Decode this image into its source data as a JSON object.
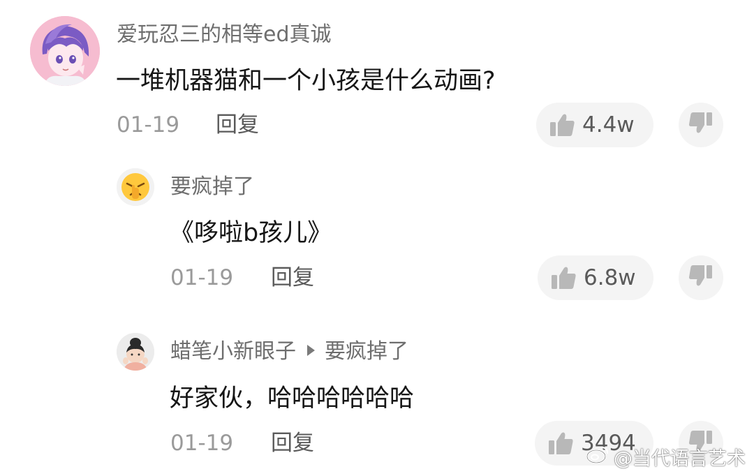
{
  "comments": [
    {
      "username": "爱玩忍三的相等ed真诚",
      "text": "一堆机器猫和一个小孩是什么动画?",
      "date": "01-19",
      "reply_label": "回复",
      "likes": "4.4w"
    },
    {
      "username": "要疯掉了",
      "text": "《哆啦b孩儿》",
      "date": "01-19",
      "reply_label": "回复",
      "likes": "6.8w"
    },
    {
      "username": "蜡笔小新眼子",
      "reply_to": "要疯掉了",
      "text": "好家伙，哈哈哈哈哈哈",
      "date": "01-19",
      "reply_label": "回复",
      "likes": "3494"
    }
  ],
  "watermark": "@当代语言艺术",
  "icons": {
    "like": "thumbs-up-icon",
    "dislike": "thumbs-down-icon",
    "watermark_logo": "weibo-icon"
  },
  "colors": {
    "username": "#6e6e6e",
    "meta": "#9a9a9a",
    "pill_bg": "#f4f4f4",
    "icon": "#b8b8b8"
  }
}
